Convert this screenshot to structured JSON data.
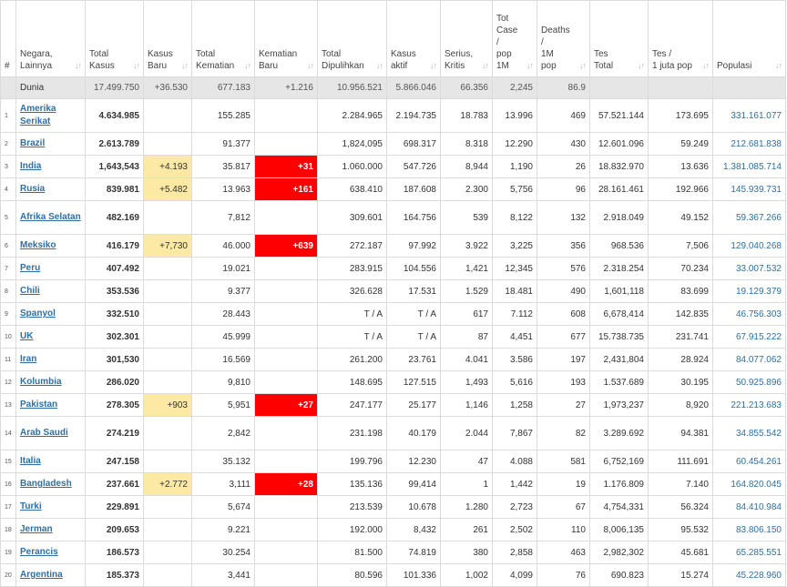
{
  "headers": [
    {
      "label": "#"
    },
    {
      "label": "Negara,\nLainnya"
    },
    {
      "label": "Total\nKasus"
    },
    {
      "label": "Kasus\nBaru"
    },
    {
      "label": "Total\nKematian"
    },
    {
      "label": "Kematian\nBaru"
    },
    {
      "label": "Total\nDipulihkan"
    },
    {
      "label": "Kasus\naktif"
    },
    {
      "label": "Serius,\nKritis"
    },
    {
      "label": "Tot\nCase\n/\npop\n1M"
    },
    {
      "label": "Deaths\n/\n1M\npop"
    },
    {
      "label": "Tes\nTotal"
    },
    {
      "label": "Tes /\n1 juta pop"
    },
    {
      "label": "Populasi"
    }
  ],
  "world": {
    "name": "Dunia",
    "total": "17.499.750",
    "new": "+36.530",
    "deaths": "677.183",
    "new_deaths": "+1.216",
    "recovered": "10.956.521",
    "active": "5.866.046",
    "critical": "66.356",
    "cases_per_m": "2,245",
    "deaths_per_m": "86.9",
    "tests": "",
    "tests_per_m": "",
    "population": ""
  },
  "rows": [
    {
      "idx": "1",
      "name": "Amerika Serikat",
      "total": "4.634.985",
      "new": "",
      "deaths": "155.285",
      "new_deaths": "",
      "recovered": "2.284.965",
      "active": "2.194.735",
      "critical": "18.783",
      "cases_per_m": "13.996",
      "deaths_per_m": "469",
      "tests": "57.521.144",
      "tests_per_m": "173.695",
      "population": "331.161.077"
    },
    {
      "idx": "2",
      "name": "Brazil",
      "total": "2.613.789",
      "new": "",
      "deaths": "91.377",
      "new_deaths": "",
      "recovered": "1,824,095",
      "active": "698.317",
      "critical": "8.318",
      "cases_per_m": "12.290",
      "deaths_per_m": "430",
      "tests": "12.601.096",
      "tests_per_m": "59.249",
      "population": "212.681.838"
    },
    {
      "idx": "3",
      "name": "India",
      "total": "1,643,543",
      "new": "+4.193",
      "deaths": "35.817",
      "new_deaths": "+31",
      "recovered": "1.060.000",
      "active": "547.726",
      "critical": "8,944",
      "cases_per_m": "1,190",
      "deaths_per_m": "26",
      "tests": "18.832.970",
      "tests_per_m": "13.636",
      "population": "1.381.085.714"
    },
    {
      "idx": "4",
      "name": "Rusia",
      "total": "839.981",
      "new": "+5.482",
      "deaths": "13.963",
      "new_deaths": "+161",
      "recovered": "638.410",
      "active": "187.608",
      "critical": "2.300",
      "cases_per_m": "5,756",
      "deaths_per_m": "96",
      "tests": "28.161.461",
      "tests_per_m": "192.966",
      "population": "145.939.731"
    },
    {
      "idx": "5",
      "name": "Afrika Selatan",
      "total": "482.169",
      "new": "",
      "deaths": "7,812",
      "new_deaths": "",
      "recovered": "309.601",
      "active": "164.756",
      "critical": "539",
      "cases_per_m": "8,122",
      "deaths_per_m": "132",
      "tests": "2.918.049",
      "tests_per_m": "49.152",
      "population": "59.367.266"
    },
    {
      "idx": "6",
      "name": "Meksiko",
      "total": "416.179",
      "new": "+7,730",
      "deaths": "46.000",
      "new_deaths": "+639",
      "recovered": "272.187",
      "active": "97.992",
      "critical": "3.922",
      "cases_per_m": "3,225",
      "deaths_per_m": "356",
      "tests": "968.536",
      "tests_per_m": "7,506",
      "population": "129.040.268"
    },
    {
      "idx": "7",
      "name": "Peru",
      "total": "407.492",
      "new": "",
      "deaths": "19.021",
      "new_deaths": "",
      "recovered": "283.915",
      "active": "104.556",
      "critical": "1,421",
      "cases_per_m": "12,345",
      "deaths_per_m": "576",
      "tests": "2.318.254",
      "tests_per_m": "70.234",
      "population": "33.007.532"
    },
    {
      "idx": "8",
      "name": "Chili",
      "total": "353.536",
      "new": "",
      "deaths": "9.377",
      "new_deaths": "",
      "recovered": "326.628",
      "active": "17.531",
      "critical": "1.529",
      "cases_per_m": "18.481",
      "deaths_per_m": "490",
      "tests": "1,601,118",
      "tests_per_m": "83.699",
      "population": "19.129.379"
    },
    {
      "idx": "9",
      "name": "Spanyol",
      "total": "332.510",
      "new": "",
      "deaths": "28.443",
      "new_deaths": "",
      "recovered": "T / A",
      "active": "T / A",
      "critical": "617",
      "cases_per_m": "7.112",
      "deaths_per_m": "608",
      "tests": "6,678,414",
      "tests_per_m": "142.835",
      "population": "46.756.303"
    },
    {
      "idx": "10",
      "name": "UK",
      "total": "302.301",
      "new": "",
      "deaths": "45.999",
      "new_deaths": "",
      "recovered": "T / A",
      "active": "T / A",
      "critical": "87",
      "cases_per_m": "4,451",
      "deaths_per_m": "677",
      "tests": "15.738.735",
      "tests_per_m": "231.741",
      "population": "67.915.222"
    },
    {
      "idx": "11",
      "name": "Iran",
      "total": "301,530",
      "new": "",
      "deaths": "16.569",
      "new_deaths": "",
      "recovered": "261.200",
      "active": "23.761",
      "critical": "4.041",
      "cases_per_m": "3.586",
      "deaths_per_m": "197",
      "tests": "2,431,804",
      "tests_per_m": "28.924",
      "population": "84.077.062"
    },
    {
      "idx": "12",
      "name": "Kolumbia",
      "total": "286.020",
      "new": "",
      "deaths": "9,810",
      "new_deaths": "",
      "recovered": "148.695",
      "active": "127.515",
      "critical": "1,493",
      "cases_per_m": "5,616",
      "deaths_per_m": "193",
      "tests": "1.537.689",
      "tests_per_m": "30.195",
      "population": "50.925.896"
    },
    {
      "idx": "13",
      "name": "Pakistan",
      "total": "278.305",
      "new": "+903",
      "deaths": "5,951",
      "new_deaths": "+27",
      "recovered": "247.177",
      "active": "25.177",
      "critical": "1,146",
      "cases_per_m": "1,258",
      "deaths_per_m": "27",
      "tests": "1,973,237",
      "tests_per_m": "8,920",
      "population": "221.213.683"
    },
    {
      "idx": "14",
      "name": "Arab Saudi",
      "total": "274.219",
      "new": "",
      "deaths": "2,842",
      "new_deaths": "",
      "recovered": "231.198",
      "active": "40.179",
      "critical": "2.044",
      "cases_per_m": "7,867",
      "deaths_per_m": "82",
      "tests": "3.289.692",
      "tests_per_m": "94.381",
      "population": "34.855.542"
    },
    {
      "idx": "15",
      "name": "Italia",
      "total": "247.158",
      "new": "",
      "deaths": "35.132",
      "new_deaths": "",
      "recovered": "199.796",
      "active": "12.230",
      "critical": "47",
      "cases_per_m": "4.088",
      "deaths_per_m": "581",
      "tests": "6,752,169",
      "tests_per_m": "111.691",
      "population": "60.454.261"
    },
    {
      "idx": "16",
      "name": "Bangladesh",
      "total": "237.661",
      "new": "+2.772",
      "deaths": "3,111",
      "new_deaths": "+28",
      "recovered": "135.136",
      "active": "99,414",
      "critical": "1",
      "cases_per_m": "1,442",
      "deaths_per_m": "19",
      "tests": "1.176.809",
      "tests_per_m": "7.140",
      "population": "164.820.045"
    },
    {
      "idx": "17",
      "name": "Turki",
      "total": "229.891",
      "new": "",
      "deaths": "5,674",
      "new_deaths": "",
      "recovered": "213.539",
      "active": "10.678",
      "critical": "1.280",
      "cases_per_m": "2,723",
      "deaths_per_m": "67",
      "tests": "4,754,331",
      "tests_per_m": "56.324",
      "population": "84.410.984"
    },
    {
      "idx": "18",
      "name": "Jerman",
      "total": "209.653",
      "new": "",
      "deaths": "9.221",
      "new_deaths": "",
      "recovered": "192.000",
      "active": "8,432",
      "critical": "261",
      "cases_per_m": "2,502",
      "deaths_per_m": "110",
      "tests": "8,006,135",
      "tests_per_m": "95.532",
      "population": "83.806.150"
    },
    {
      "idx": "19",
      "name": "Perancis",
      "total": "186.573",
      "new": "",
      "deaths": "30.254",
      "new_deaths": "",
      "recovered": "81.500",
      "active": "74.819",
      "critical": "380",
      "cases_per_m": "2,858",
      "deaths_per_m": "463",
      "tests": "2,982,302",
      "tests_per_m": "45.681",
      "population": "65.285.551"
    },
    {
      "idx": "20",
      "name": "Argentina",
      "total": "185.373",
      "new": "",
      "deaths": "3,441",
      "new_deaths": "",
      "recovered": "80.596",
      "active": "101.336",
      "critical": "1,002",
      "cases_per_m": "4,099",
      "deaths_per_m": "76",
      "tests": "690.823",
      "tests_per_m": "15.274",
      "population": "45.228.960"
    }
  ],
  "colors": {
    "link": "#2e6fa6",
    "new_case_bg": "#fce9a4",
    "new_death_bg": "#ff0000",
    "world_bg": "#e6e6e6",
    "border": "#dcdcdc"
  },
  "icons": {
    "sort": "sort-arrows-icon"
  }
}
